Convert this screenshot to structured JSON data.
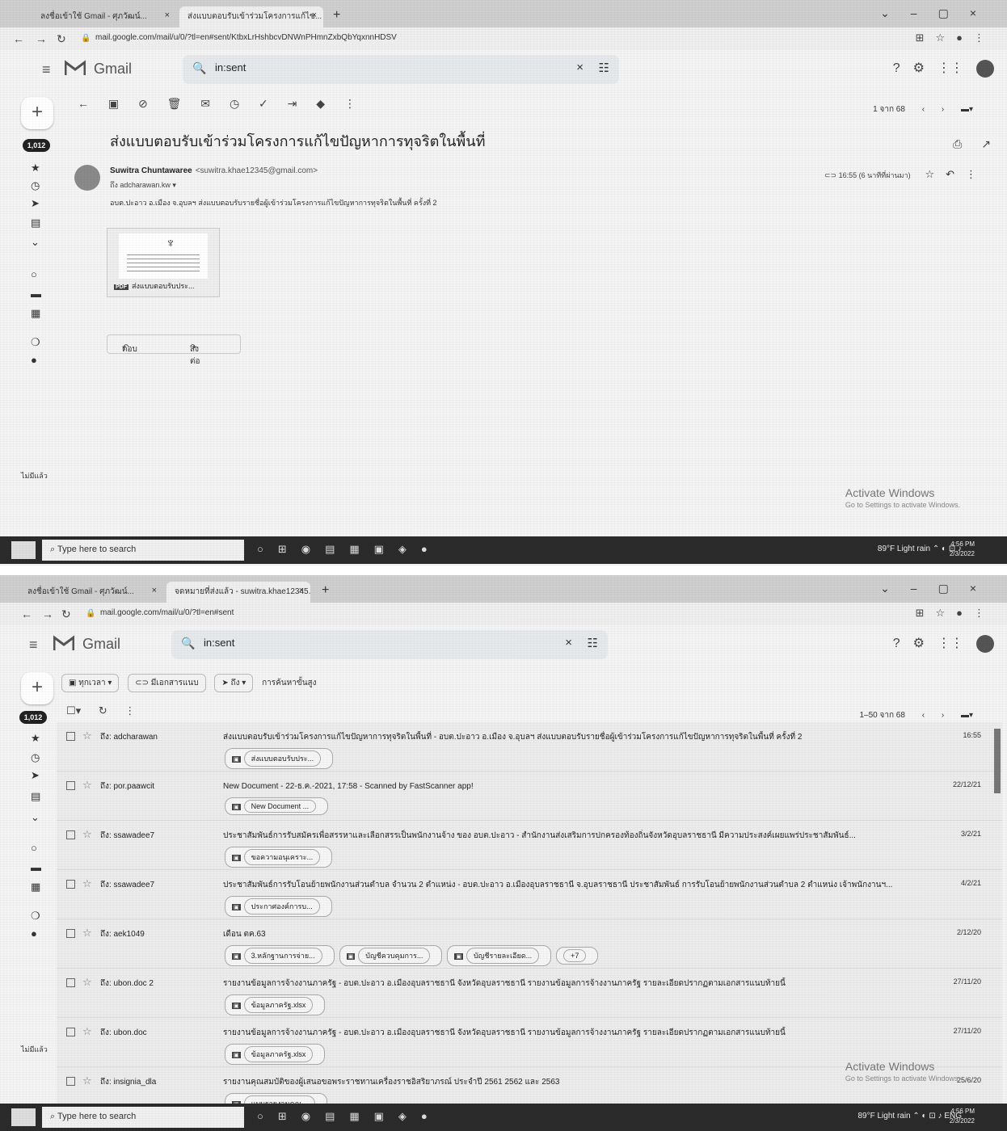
{
  "shot1": {
    "tabs": [
      "ลงชื่อเข้าใช้ Gmail - ศุภวัฒน์...",
      "ส่งแบบตอบรับเข้าร่วมโครงการแก้ไข..."
    ],
    "url": "mail.google.com/mail/u/0/?tl=en#sent/KtbxLrHshbcvDNWnPHmnZxbQbYqxnnHDSV",
    "app_name": "Gmail",
    "search_value": "in:sent",
    "unread_badge": "1,012",
    "pager": "1 จาก 68",
    "subject": "ส่งแบบตอบรับเข้าร่วมโครงการแก้ไขปัญหาการทุจริตในพื้นที่",
    "sender_name": "Suwitra Chuntawaree",
    "sender_email": "<suwitra.khae12345@gmail.com>",
    "to_line": "ถึง adcharawan.kw ▾",
    "time": "16:55 (6 นาทีที่ผ่านมา)",
    "body": "อบต.ปะอาว อ.เมือง จ.อุบลฯ ส่งแบบตอบรับรายชื่อผู้เข้าร่วมโครงการแก้ไขปัญหาการทุจริตในพื้นที่ ครั้งที่ 2",
    "attachment_name": "ส่งแบบตอบรับประ...",
    "reply_label": "ตอบ",
    "forward_label": "ส่งต่อ",
    "activate_title": "Activate Windows",
    "activate_sub": "Go to Settings to activate Windows.",
    "more_label": "ไม่มีแล้ว"
  },
  "shot2": {
    "tabs": [
      "ลงชื่อเข้าใช้ Gmail - ศุภวัฒน์...",
      "จดหมายที่ส่งแล้ว - suwitra.khae12345..."
    ],
    "url": "mail.google.com/mail/u/0/?tl=en#sent",
    "app_name": "Gmail",
    "search_value": "in:sent",
    "unread_badge": "1,012",
    "filters": [
      "ทุกเวลา ▾",
      "มีเอกสารแนบ",
      "ถึง ▾"
    ],
    "advanced_search": "การค้นหาขั้นสูง",
    "pager": "1–50 จาก 68",
    "activate_title": "Activate Windows",
    "activate_sub": "Go to Settings to activate Windows.",
    "rows": [
      {
        "from": "ถึง: adcharawan",
        "text": "ส่งแบบตอบรับเข้าร่วมโครงการแก้ไขปัญหาการทุจริตในพื้นที่ - อบต.ปะอาว อ.เมือง จ.อุบลฯ ส่งแบบตอบรับรายชื่อผู้เข้าร่วมโครงการแก้ไขปัญหาการทุจริตในพื้นที่ ครั้งที่ 2",
        "date": "16:55",
        "chips": [
          "ส่งแบบตอบรับประ..."
        ]
      },
      {
        "from": "ถึง: por.paawcit",
        "text": "New Document - 22-ธ.ค.-2021, 17:58 - Scanned by FastScanner app!",
        "date": "22/12/21",
        "chips": [
          "New Document ..."
        ]
      },
      {
        "from": "ถึง: ssawadee7",
        "text": "ประชาสัมพันธ์การรับสมัครเพื่อสรรหาและเลือกสรรเป็นพนักงานจ้าง ของ อบต.ปะอาว - สำนักงานส่งเสริมการปกครองท้องถิ่นจังหวัดอุบลราชธานี มีความประสงค์เผยแพร่ประชาสัมพันธ์...",
        "date": "3/2/21",
        "chips": [
          "ขอความอนุเคราะ..."
        ]
      },
      {
        "from": "ถึง: ssawadee7",
        "text": "ประชาสัมพันธ์การรับโอนย้ายพนักงานส่วนตำบล จำนวน 2 ตำแหน่ง - อบต.ปะอาว อ.เมืองอุบลราชธานี จ.อุบลราชธานี ประชาสัมพันธ์ การรับโอนย้ายพนักงานส่วนตำบล 2 ตำแหน่ง เจ้าพนักงานฯ...",
        "date": "4/2/21",
        "chips": [
          "ประกาศองค์การบ..."
        ]
      },
      {
        "from": "ถึง: aek1049",
        "text": "เดือน ตค.63",
        "date": "2/12/20",
        "chips": [
          "3.หลักฐานการจ่าย...",
          "บัญชีควบคุมการ...",
          "บัญชีรายละเอียด...",
          "+7"
        ]
      },
      {
        "from": "ถึง: ubon.doc 2",
        "text": "รายงานข้อมูลการจ้างงานภาครัฐ - อบต.ปะอาว อ.เมืองอุบลราชธานี จังหวัดอุบลราชธานี รายงานข้อมูลการจ้างงานภาครัฐ รายละเอียดปรากฏตามเอกสารแนบท้ายนี้",
        "date": "27/11/20",
        "chips": [
          "ข้อมูลภาครัฐ.xlsx"
        ]
      },
      {
        "from": "ถึง: ubon.doc",
        "text": "รายงานข้อมูลการจ้างงานภาครัฐ - อบต.ปะอาว อ.เมืองอุบลราชธานี จังหวัดอุบลราชธานี รายงานข้อมูลการจ้างงานภาครัฐ รายละเอียดปรากฏตามเอกสารแนบท้ายนี้",
        "date": "27/11/20",
        "chips": [
          "ข้อมูลภาครัฐ.xlsx"
        ]
      },
      {
        "from": "ถึง: insignia_dla",
        "text": "รายงานคุณสมบัติของผู้เสนอขอพระราชทานเครื่องราชอิสริยาภรณ์ ประจำปี 2561 2562 และ 2563",
        "date": "25/6/20",
        "chips": [
          "แบบรายงานคุณ..."
        ]
      }
    ]
  },
  "taskbar": {
    "search_placeholder": "Type here to search",
    "weather": "89°F Light rain",
    "lang": "ENG",
    "time": "4:56 PM",
    "date": "2/3/2022"
  }
}
